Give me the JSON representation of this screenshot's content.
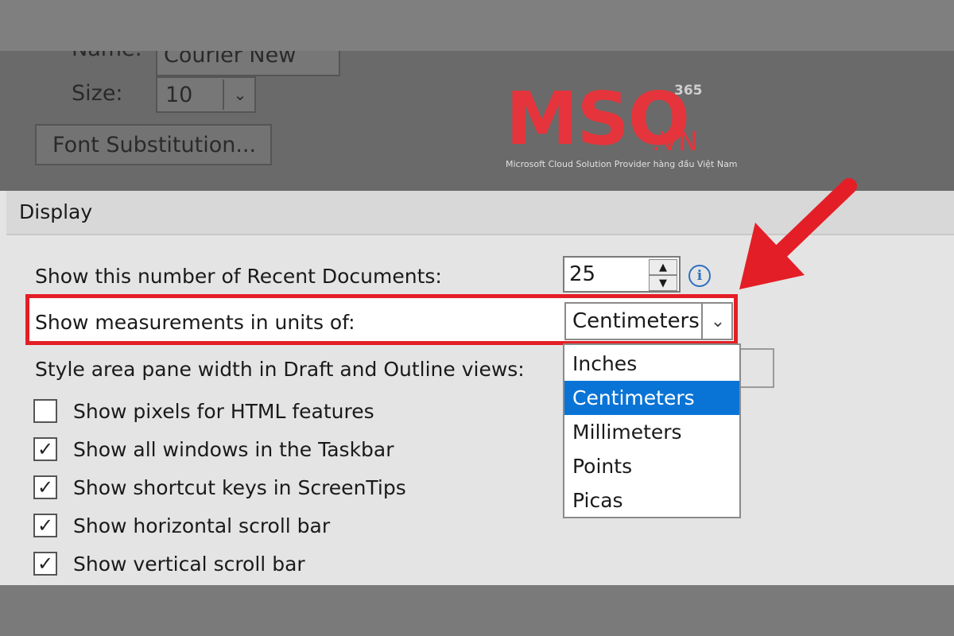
{
  "font_section": {
    "name_label": "Name:",
    "name_value": "Courier New",
    "size_label": "Size:",
    "size_value": "10",
    "font_substitution_label": "Font Substitution..."
  },
  "logo": {
    "text": "MSO",
    "suffix": ".VN",
    "superscript": "365",
    "tagline": "Microsoft Cloud Solution Provider hàng đầu Việt Nam"
  },
  "display": {
    "title": "Display",
    "recent_docs_label": "Show this number of Recent Documents:",
    "recent_docs_value": "25",
    "measurements_label": "Show measurements in units of:",
    "measurements_value": "Centimeters",
    "style_area_label": "Style area pane width in Draft and Outline views:",
    "unit_options": [
      "Inches",
      "Centimeters",
      "Millimeters",
      "Points",
      "Picas"
    ],
    "selected_option_index": 1,
    "checkboxes": [
      {
        "label": "Show pixels for HTML features",
        "checked": false
      },
      {
        "label": "Show all windows in the Taskbar",
        "checked": true
      },
      {
        "label": "Show shortcut keys in ScreenTips",
        "checked": true
      },
      {
        "label": "Show horizontal scroll bar",
        "checked": true
      },
      {
        "label": "Show vertical scroll bar",
        "checked": true
      }
    ]
  },
  "colors": {
    "highlight": "#e41e26",
    "selection": "#0a74d6",
    "logo_red": "#e5343b"
  }
}
